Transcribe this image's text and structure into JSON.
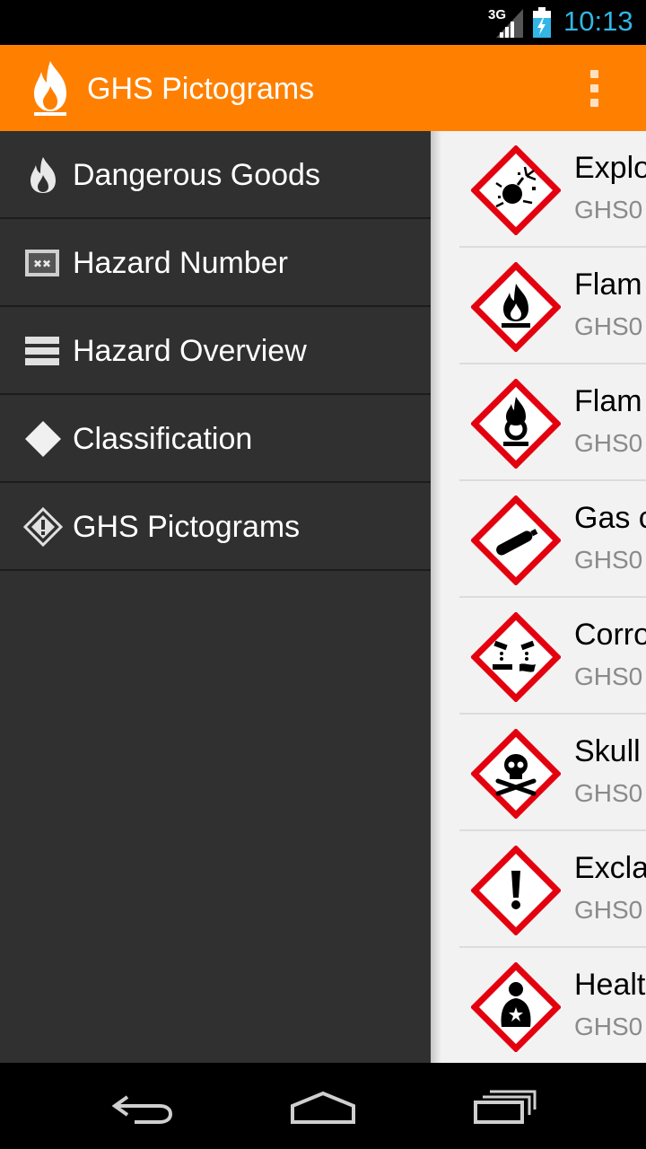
{
  "status_bar": {
    "network": "3G",
    "time": "10:13",
    "time_color": "#33b5e5"
  },
  "action_bar": {
    "title": "GHS Pictograms",
    "app_icon": "flame-icon",
    "menu_icon": "overflow-menu-icon",
    "color": "#ff8000"
  },
  "drawer": {
    "items": [
      {
        "label": "Dangerous Goods",
        "icon": "flame-icon"
      },
      {
        "label": "Hazard Number",
        "icon": "hazard-plate-icon"
      },
      {
        "label": "Hazard Overview",
        "icon": "list-icon"
      },
      {
        "label": "Classification",
        "icon": "diamond-icon"
      },
      {
        "label": "GHS Pictograms",
        "icon": "warning-diamond-icon"
      }
    ]
  },
  "pictograms": [
    {
      "name": "Explo",
      "code": "GHS0",
      "icon": "exploding-bomb-icon"
    },
    {
      "name": "Flam",
      "code": "GHS0",
      "icon": "flame-icon"
    },
    {
      "name": "Flam",
      "code": "GHS0",
      "icon": "flame-over-circle-icon"
    },
    {
      "name": "Gas c",
      "code": "GHS0",
      "icon": "gas-cylinder-icon"
    },
    {
      "name": "Corro",
      "code": "GHS0",
      "icon": "corrosion-icon"
    },
    {
      "name": "Skull",
      "code": "GHS0",
      "icon": "skull-crossbones-icon"
    },
    {
      "name": "Excla",
      "code": "GHS0",
      "icon": "exclamation-mark-icon"
    },
    {
      "name": "Healt",
      "code": "GHS0",
      "icon": "health-hazard-icon"
    }
  ],
  "nav_bar": {
    "back_icon": "back-icon",
    "home_icon": "home-icon",
    "recents_icon": "recents-icon"
  }
}
